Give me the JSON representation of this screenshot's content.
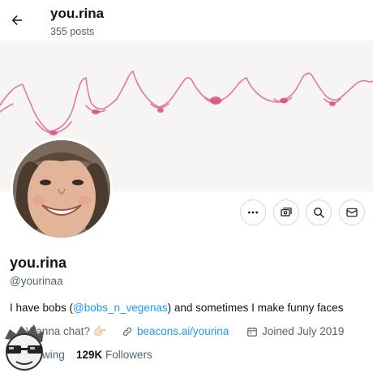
{
  "header": {
    "back_icon": "arrow-left-icon",
    "name": "you.rina",
    "posts": "355 posts"
  },
  "banner": {
    "description_color": "#e07aa0"
  },
  "actions": [
    {
      "name": "more",
      "icon": "ellipsis-icon"
    },
    {
      "name": "subscribe",
      "icon": "money-icon"
    },
    {
      "name": "search",
      "icon": "search-icon"
    },
    {
      "name": "message",
      "icon": "mail-icon"
    }
  ],
  "profile": {
    "name": "you.rina",
    "handle": "@yourinaa",
    "bio_prefix": "I have bobs (",
    "bio_mention": "@bobs_n_vegenas",
    "bio_suffix": ") and sometimes I make funny faces",
    "meta_wanna": "Wanna chat? 👉🏻",
    "meta_link": "beacons.ai/yourina",
    "meta_joined": "Joined July 2019",
    "following_label": "wing",
    "followers_count": "129K",
    "followers_label": "Followers"
  },
  "colors": {
    "accent": "#1d9bf0",
    "muted": "#536471",
    "text": "#0f1419"
  }
}
